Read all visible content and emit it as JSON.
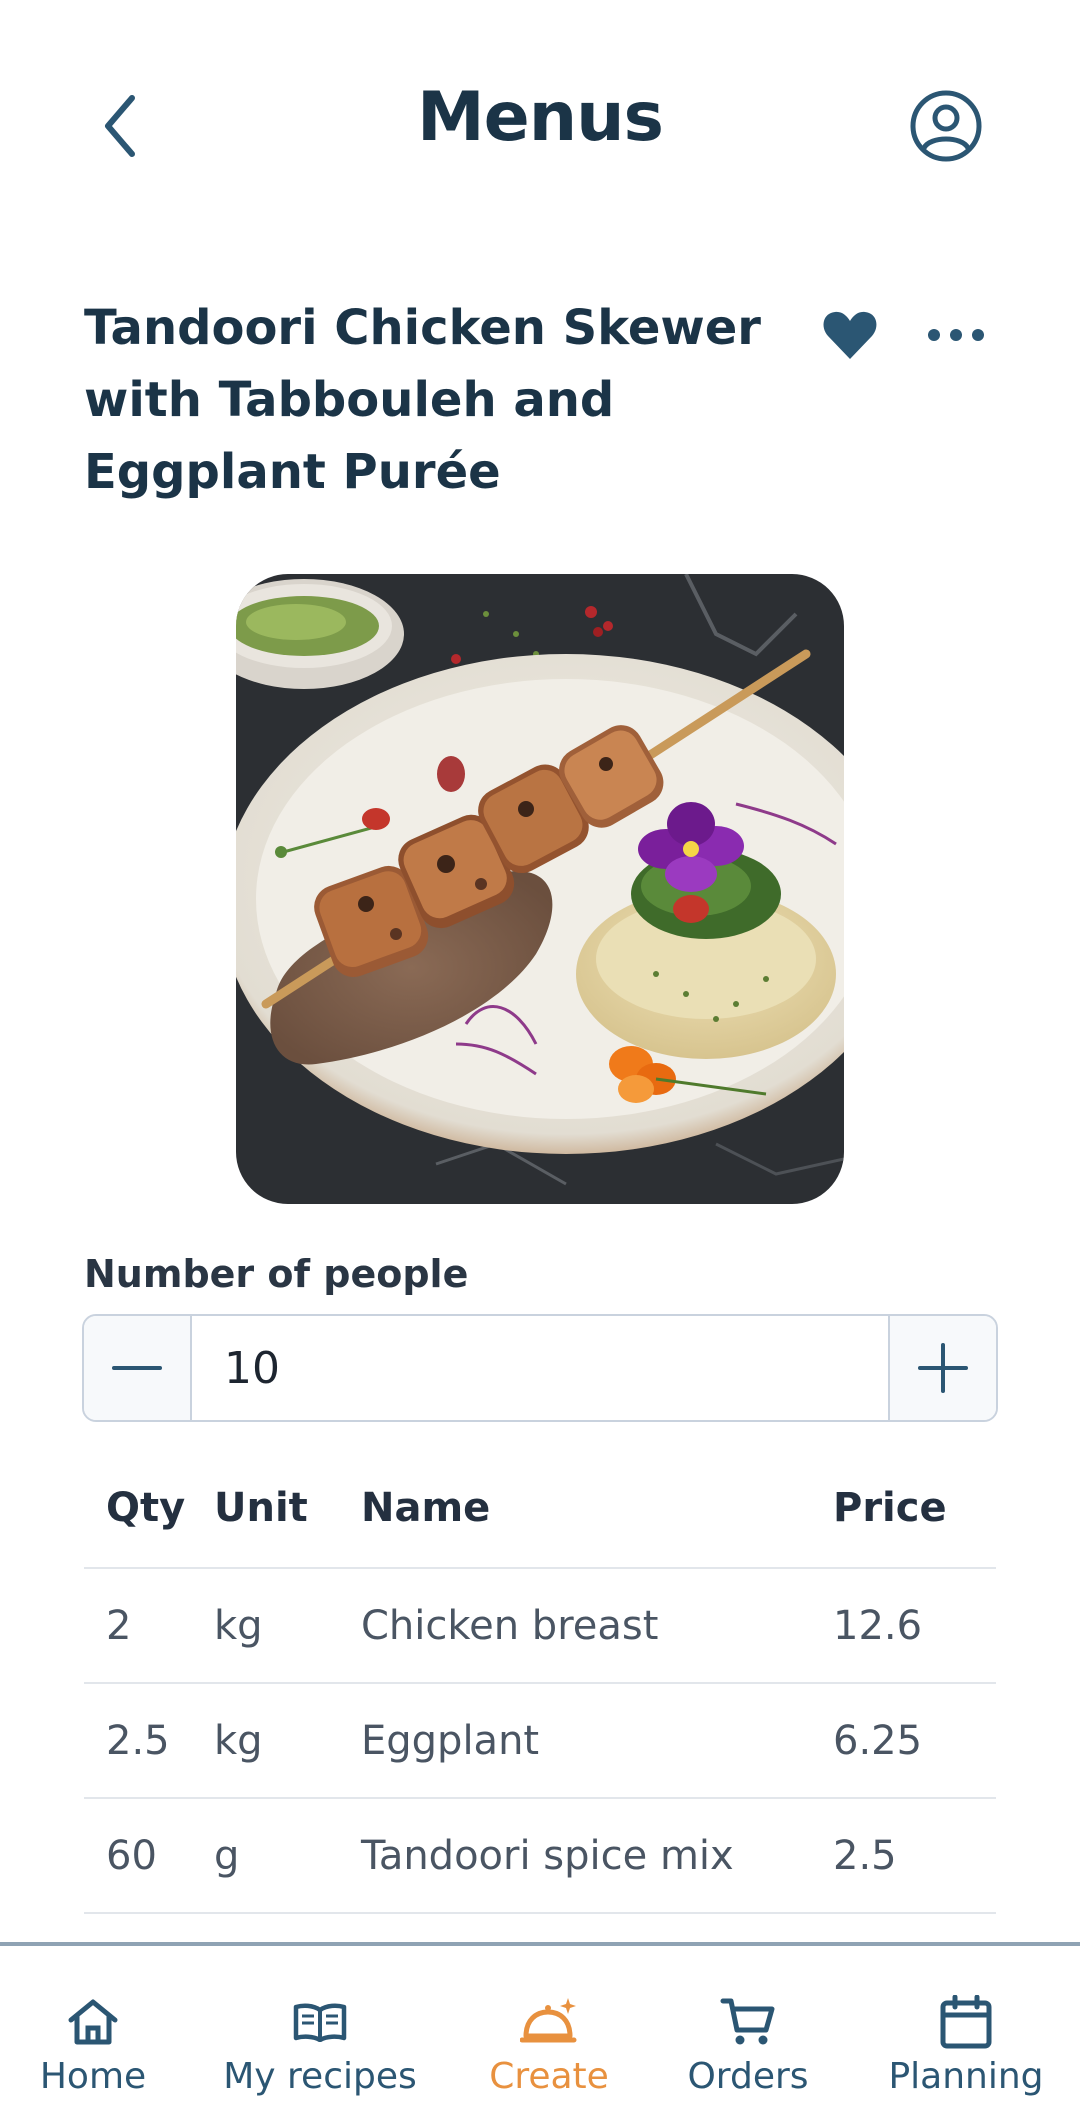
{
  "header": {
    "title": "Menus"
  },
  "recipe": {
    "title": "Tandoori Chicken Skewer with Tabbouleh and Eggplant Purée",
    "favorited": true,
    "image_alt": "Tandoori chicken skewer on eggplant purée with tabbouleh"
  },
  "people": {
    "label": "Number of people",
    "value": "10"
  },
  "table": {
    "headers": {
      "qty": "Qty",
      "unit": "Unit",
      "name": "Name",
      "price": "Price"
    },
    "rows": [
      {
        "qty": "2",
        "unit": "kg",
        "name": "Chicken breast",
        "price": "12.6"
      },
      {
        "qty": "2.5",
        "unit": "kg",
        "name": "Eggplant",
        "price": "6.25"
      },
      {
        "qty": "60",
        "unit": "g",
        "name": "Tandoori spice mix",
        "price": "2.5"
      }
    ]
  },
  "nav": {
    "items": [
      {
        "label": "Home",
        "icon": "home-icon",
        "active": false
      },
      {
        "label": "My recipes",
        "icon": "book-icon",
        "active": false
      },
      {
        "label": "Create",
        "icon": "cloche-icon",
        "active": true
      },
      {
        "label": "Orders",
        "icon": "cart-icon",
        "active": false
      },
      {
        "label": "Planning",
        "icon": "calendar-icon",
        "active": false
      }
    ]
  },
  "colors": {
    "primary": "#1b3447",
    "nav": "#2b5673",
    "accent": "#e8913f",
    "border": "#c9d2de"
  }
}
